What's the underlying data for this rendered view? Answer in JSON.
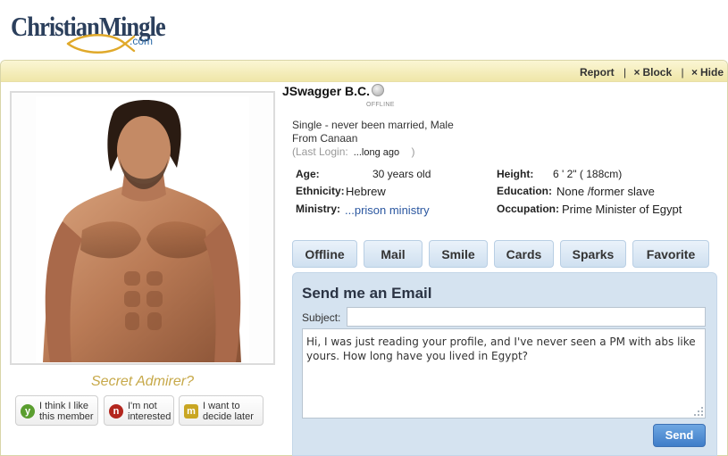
{
  "logo": {
    "brand": "ChristianMingle",
    "suffix": ".com"
  },
  "actions": {
    "report": "Report",
    "block": "Block",
    "hide": "Hide",
    "close_glyph": "×"
  },
  "profile": {
    "name": "JSwagger B.C.",
    "online_status": "OFFLINE",
    "summary": "Single - never been married, Male",
    "from_label": "From",
    "from_value": "Canaan",
    "last_login_open": "(Last Login:",
    "last_login_value": "...long ago",
    "last_login_close": ")",
    "fields": {
      "age_label": "Age:",
      "age_value": "30 years old",
      "ethnicity_label": "Ethnicity:",
      "ethnicity_value": "Hebrew",
      "ministry_label": "Ministry:",
      "ministry_value": "...prison ministry",
      "height_label": "Height:",
      "height_value": "6 ' 2\" ( 188cm)",
      "education_label": "Education:",
      "education_value": "None /former slave",
      "occupation_label": "Occupation:",
      "occupation_value": "Prime Minister of Egypt"
    }
  },
  "admirer": {
    "title": "Secret Admirer?",
    "buttons": [
      {
        "badge": "y",
        "line1": "I think I like",
        "line2": "this member",
        "color": "#5a9e2f"
      },
      {
        "badge": "n",
        "line1": "I'm not",
        "line2": "interested",
        "color": "#b3261e"
      },
      {
        "badge": "m",
        "line1": "I want to",
        "line2": "decide later",
        "color": "#c9a623"
      }
    ]
  },
  "tabs": [
    "Offline",
    "Mail",
    "Smile",
    "Cards",
    "Sparks",
    "Favorite"
  ],
  "email": {
    "title": "Send me an Email",
    "subject_label": "Subject:",
    "subject_value": "",
    "message": "Hi, I was just reading your profile, and I've never seen a PM with abs like yours. How long have you lived in Egypt?",
    "send_label": "Send"
  },
  "colors": {
    "accent_blue": "#3f7dc8",
    "panel_bar": "#efe6a8",
    "email_bg": "#d5e3f0"
  }
}
